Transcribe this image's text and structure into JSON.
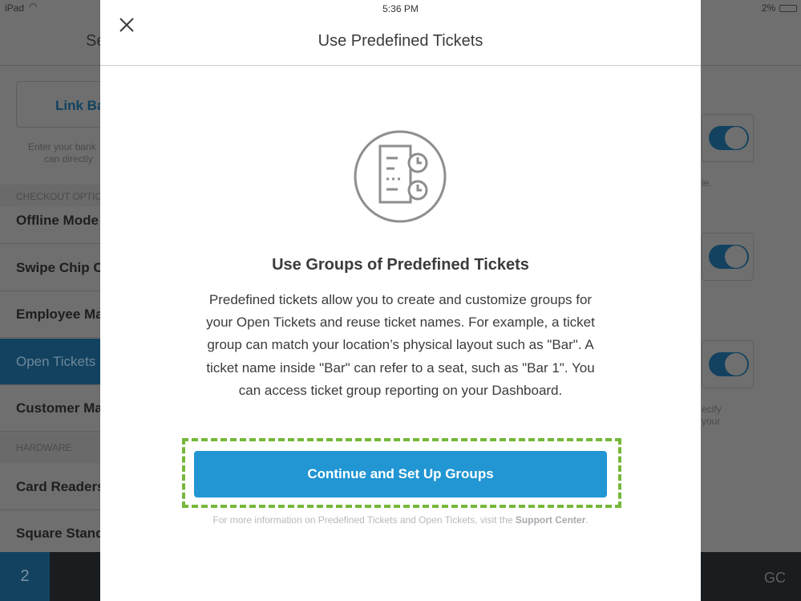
{
  "status_bar": {
    "device": "iPad",
    "time": "5:36 PM",
    "battery": "2%"
  },
  "background": {
    "title": "Se",
    "link_bank_label": "Link Ba",
    "hint_lines": [
      "Enter your bank",
      "can directly"
    ],
    "sections": [
      "CHECKOUT OPTIO",
      "HARDWARE"
    ],
    "items": [
      "Offline Mode",
      "Swipe Chip C",
      "Employee Ma",
      "Open Tickets",
      "Customer Ma",
      "Card Readers",
      "Square Stand"
    ],
    "selected_item": "Open Tickets",
    "right_text": [
      "le.",
      "ecify",
      "your"
    ],
    "toggles": [
      true,
      true,
      true
    ],
    "badge": "2",
    "initials": "GC"
  },
  "modal": {
    "title": "Use Predefined Tickets",
    "icon": "predefined-tickets-icon",
    "heading": "Use Groups of Predefined Tickets",
    "body": "Predefined tickets allow you to create and customize groups for your Open Tickets and reuse ticket names. For example, a ticket group can match your location’s physical layout such as \"Bar\". A ticket name inside \"Bar\" can refer to a seat, such as \"Bar 1\". You can access ticket group reporting on your Dashboard.",
    "cta": "Continue and Set Up Groups",
    "footer_text": "For more information on Predefined Tickets and Open Tickets, visit the ",
    "footer_link": "Support Center",
    "footer_end": "."
  },
  "colors": {
    "accent": "#2196d3",
    "highlight": "#76b83a"
  }
}
